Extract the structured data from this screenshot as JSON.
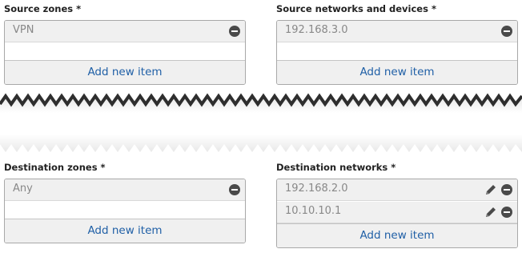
{
  "source_zones": {
    "label": "Source zones *",
    "items": [
      "VPN"
    ],
    "add_label": "Add new item"
  },
  "source_networks": {
    "label": "Source networks and devices *",
    "items": [
      "192.168.3.0"
    ],
    "add_label": "Add new item"
  },
  "destination_zones": {
    "label": "Destination zones *",
    "items": [
      "Any"
    ],
    "add_label": "Add new item"
  },
  "destination_networks": {
    "label": "Destination networks *",
    "items": [
      "192.168.2.0",
      "10.10.10.1"
    ],
    "add_label": "Add new item"
  },
  "colors": {
    "link": "#1f5fa6",
    "row_bg": "#f0f0f0",
    "border": "#a8a8a8",
    "icon": "#4a4a4a"
  },
  "icons": {
    "remove": "minus-circle-icon",
    "edit": "pencil-icon"
  }
}
